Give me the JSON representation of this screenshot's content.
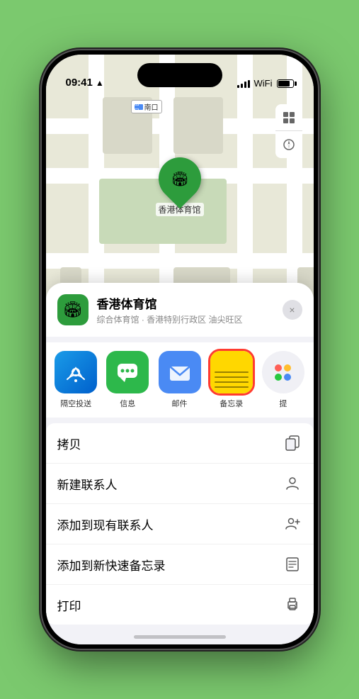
{
  "status": {
    "time": "09:41",
    "location_arrow": "▲"
  },
  "map": {
    "label_text": "南口",
    "pin_emoji": "🏟",
    "location_name": "香港体育馆",
    "map_icon": "🗺",
    "compass_icon": "⊕"
  },
  "location_card": {
    "name": "香港体育馆",
    "subtitle": "综合体育馆 · 香港特别行政区 油尖旺区",
    "close_label": "×"
  },
  "share_apps": [
    {
      "id": "airdrop",
      "label": "隔空投送",
      "type": "airdrop"
    },
    {
      "id": "messages",
      "label": "信息",
      "type": "messages"
    },
    {
      "id": "mail",
      "label": "邮件",
      "type": "mail"
    },
    {
      "id": "notes",
      "label": "备忘录",
      "type": "notes",
      "selected": true
    },
    {
      "id": "more",
      "label": "提",
      "type": "more"
    }
  ],
  "actions": [
    {
      "id": "copy",
      "label": "拷贝",
      "icon": "copy"
    },
    {
      "id": "new-contact",
      "label": "新建联系人",
      "icon": "person"
    },
    {
      "id": "add-contact",
      "label": "添加到现有联系人",
      "icon": "person-add"
    },
    {
      "id": "quick-note",
      "label": "添加到新快速备忘录",
      "icon": "note"
    },
    {
      "id": "print",
      "label": "打印",
      "icon": "print"
    }
  ]
}
